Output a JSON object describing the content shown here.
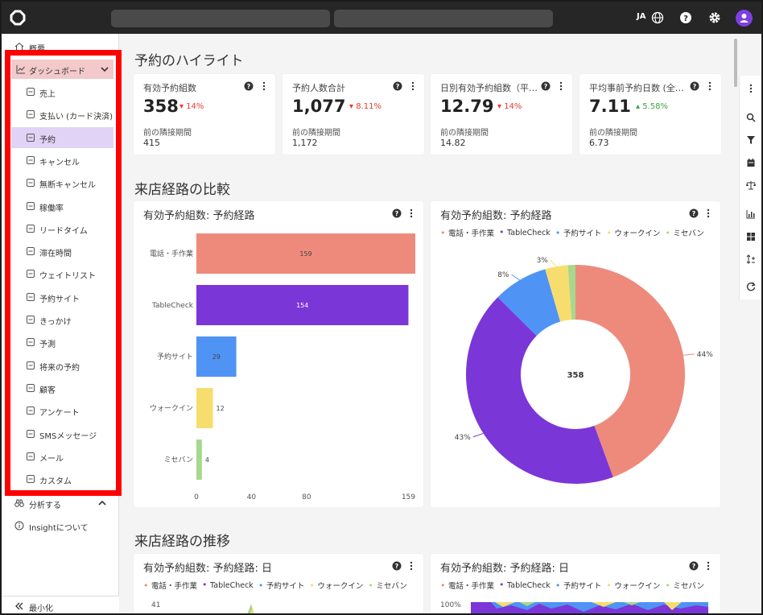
{
  "topbar": {
    "lang": "JA"
  },
  "sidebar": {
    "overview": "概要",
    "dashboard": "ダッシュボード",
    "items": [
      {
        "label": "売上",
        "icon": "money-icon"
      },
      {
        "label": "支払い (カード決済)",
        "icon": "payment-icon"
      },
      {
        "label": "予約",
        "icon": "calendar-check-icon"
      },
      {
        "label": "キャンセル",
        "icon": "calendar-x-icon"
      },
      {
        "label": "無断キャンセル",
        "icon": "circle-x-icon"
      },
      {
        "label": "稼働率",
        "icon": "occupancy-icon"
      },
      {
        "label": "リードタイム",
        "icon": "calendar-lead-icon"
      },
      {
        "label": "滞在時間",
        "icon": "clock-icon"
      },
      {
        "label": "ウェイトリスト",
        "icon": "hourglass-icon"
      },
      {
        "label": "予約サイト",
        "icon": "monitor-icon"
      },
      {
        "label": "きっかけ",
        "icon": "share-icon"
      },
      {
        "label": "予測",
        "icon": "eye-icon"
      },
      {
        "label": "将来の予約",
        "icon": "calendar-future-icon"
      },
      {
        "label": "顧客",
        "icon": "user-icon"
      },
      {
        "label": "アンケート",
        "icon": "survey-icon"
      },
      {
        "label": "SMSメッセージ",
        "icon": "chat-icon"
      },
      {
        "label": "メール",
        "icon": "mail-icon"
      },
      {
        "label": "カスタム",
        "icon": "custom-icon"
      }
    ],
    "analyze": "分析する",
    "about": "Insightについて",
    "minimize": "最小化"
  },
  "highlights": {
    "title": "予約のハイライト",
    "cards": [
      {
        "title": "有効予約組数",
        "value": "358",
        "delta": "▾ 14%",
        "delta_color": "#e53935",
        "prev_label": "前の隣接期間",
        "prev_value": "415"
      },
      {
        "title": "予約人数合計",
        "value": "1,077",
        "delta": "▾ 8.11%",
        "delta_color": "#e53935",
        "prev_label": "前の隣接期間",
        "prev_value": "1,172"
      },
      {
        "title": "日別有効予約組数（平…",
        "value": "12.79",
        "delta": "▾ 14%",
        "delta_color": "#e53935",
        "prev_label": "前の隣接期間",
        "prev_value": "14.82"
      },
      {
        "title": "平均事前予約日数 (全…",
        "value": "7.11",
        "delta": "▴ 5.58%",
        "delta_color": "#43a047",
        "prev_label": "前の隣接期間",
        "prev_value": "6.73"
      }
    ]
  },
  "comparison": {
    "title": "来店経路の比較",
    "bar_title": "有効予約組数: 予約経路",
    "donut_title": "有効予約組数: 予約経路",
    "donut_center": "358"
  },
  "trend": {
    "title": "来店経路の推移",
    "left_title": "有効予約組数: 予約経路: 日",
    "right_title": "有効予約組数: 予約経路: 日",
    "left_ytick": "41",
    "right_ytick": "100%"
  },
  "legend": [
    {
      "name": "電話・手作業",
      "color": "#ee8a7c"
    },
    {
      "name": "TableCheck",
      "color": "#7b36d8"
    },
    {
      "name": "予約サイト",
      "color": "#4f93f5"
    },
    {
      "name": "ウォークイン",
      "color": "#f7dd6e"
    },
    {
      "name": "ミセバン",
      "color": "#a7d88c"
    }
  ],
  "chart_data": [
    {
      "type": "bar",
      "title": "有効予約組数: 予約経路",
      "orientation": "horizontal",
      "categories": [
        "電話・手作業",
        "TableCheck",
        "予約サイト",
        "ウォークイン",
        "ミセバン"
      ],
      "values": [
        159,
        154,
        29,
        12,
        4
      ],
      "colors": [
        "#ee8a7c",
        "#7b36d8",
        "#4f93f5",
        "#f7dd6e",
        "#a7d88c"
      ],
      "xticks": [
        "0",
        "40",
        "80",
        "159"
      ],
      "xlim": [
        0,
        159
      ]
    },
    {
      "type": "pie",
      "title": "有効予約組数: 予約経路",
      "categories": [
        "電話・手作業",
        "TableCheck",
        "予約サイト",
        "ウォークイン",
        "ミセバン"
      ],
      "values": [
        159,
        154,
        29,
        12,
        4
      ],
      "labels": [
        "44%",
        "43%",
        "8%",
        "3%",
        ""
      ],
      "colors": [
        "#ee8a7c",
        "#7b36d8",
        "#4f93f5",
        "#f7dd6e",
        "#a7d88c"
      ],
      "center_label": "358"
    }
  ]
}
